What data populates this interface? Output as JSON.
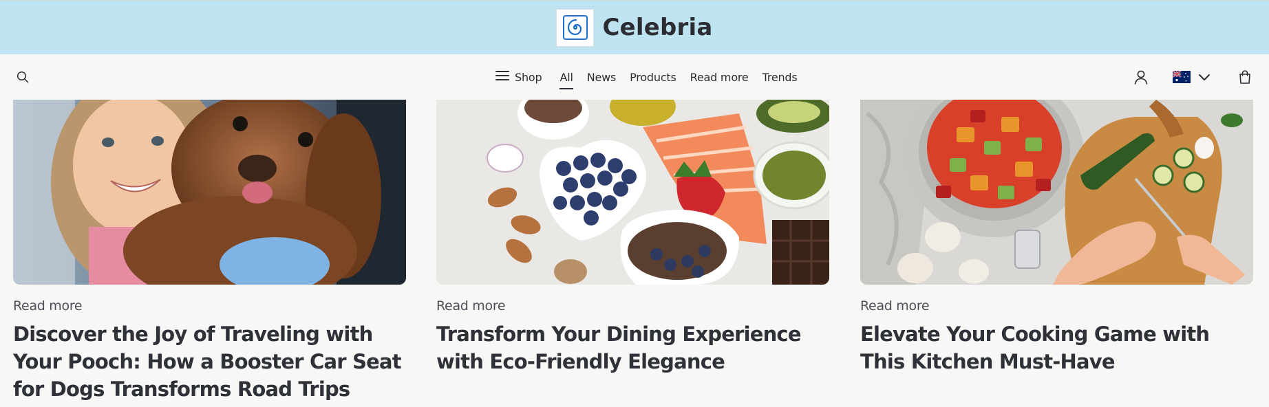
{
  "brand": {
    "name": "Celebria",
    "logo_icon": "spiral-logo-icon",
    "bar_color": "#bee3f1",
    "logo_color": "#1a6fcf"
  },
  "nav": {
    "search_icon": "search-icon",
    "shop_label": "Shop",
    "menu_icon": "hamburger-menu-icon",
    "links": [
      {
        "label": "All",
        "active": true
      },
      {
        "label": "News",
        "active": false
      },
      {
        "label": "Products",
        "active": false
      },
      {
        "label": "Read more",
        "active": false
      },
      {
        "label": "Trends",
        "active": false
      }
    ],
    "account_icon": "user-account-icon",
    "country_flag": "australia-flag-icon",
    "country_chevron": "chevron-down-icon",
    "cart_icon": "shopping-bag-icon"
  },
  "articles": [
    {
      "image": "girl-with-poodle-in-car-photo",
      "category": "Read more",
      "title": "Discover the Joy of Traveling with Your Pooch: How a Booster Car Seat for Dogs Transforms Road Trips"
    },
    {
      "image": "healthy-food-bowls-photo",
      "category": "Read more",
      "title": "Transform Your Dining Experience with Eco-Friendly Elegance"
    },
    {
      "image": "chopping-vegetables-pot-photo",
      "category": "Read more",
      "title": "Elevate Your Cooking Game with This Kitchen Must-Have"
    }
  ]
}
